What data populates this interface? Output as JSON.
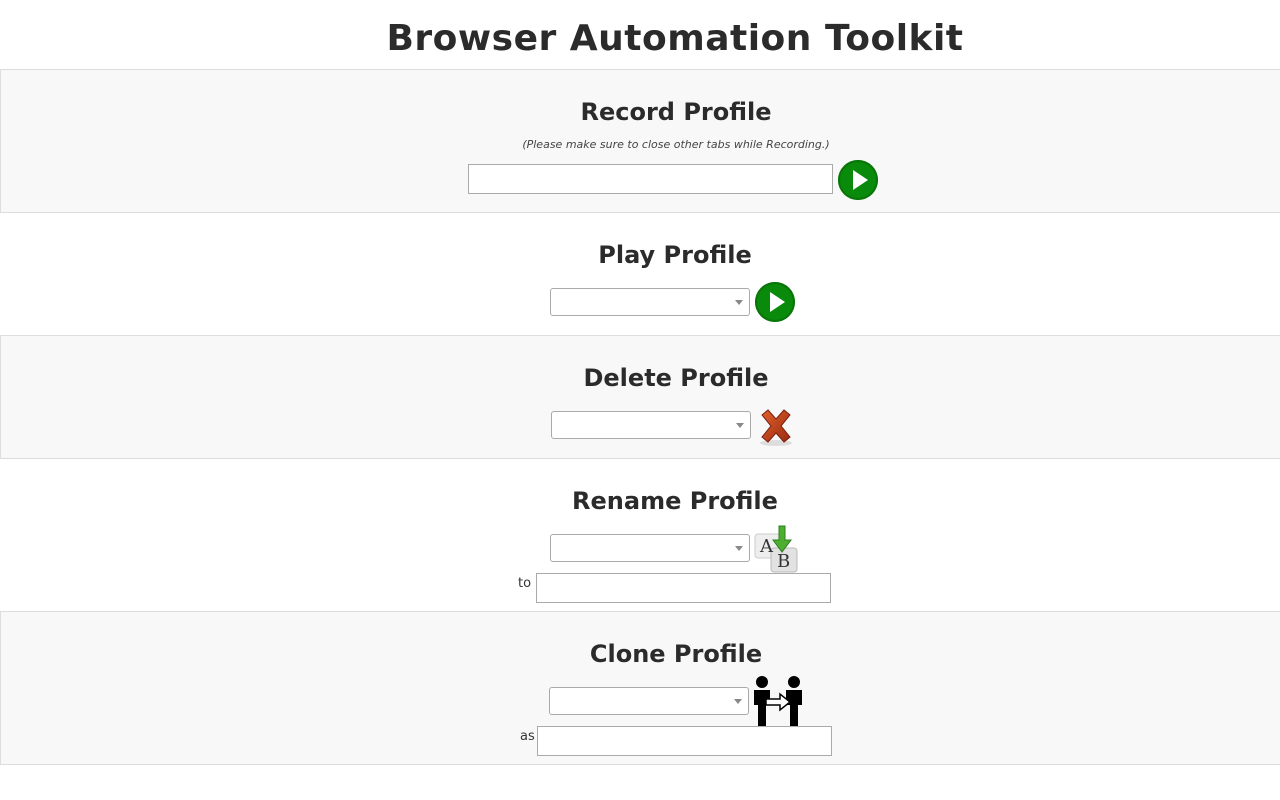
{
  "app": {
    "title": "Browser Automation Toolkit"
  },
  "record": {
    "title": "Record Profile",
    "note": "(Please make sure to close other tabs while Recording.)",
    "input_value": "",
    "button_icon": "play-icon"
  },
  "play": {
    "title": "Play Profile",
    "selected": "",
    "button_icon": "play-icon"
  },
  "delete": {
    "title": "Delete Profile",
    "selected": "",
    "button_icon": "delete-x-icon"
  },
  "rename": {
    "title": "Rename Profile",
    "selected": "",
    "to_label": "to",
    "new_name": "",
    "button_icon": "rename-a-to-b-icon"
  },
  "clone": {
    "title": "Clone Profile",
    "selected": "",
    "as_label": "as",
    "new_name": "",
    "button_icon": "clone-people-icon"
  },
  "colors": {
    "play_green": "#0a8a0a",
    "delete_red": "#c0391a",
    "panel_grey": "#f8f8f8"
  }
}
